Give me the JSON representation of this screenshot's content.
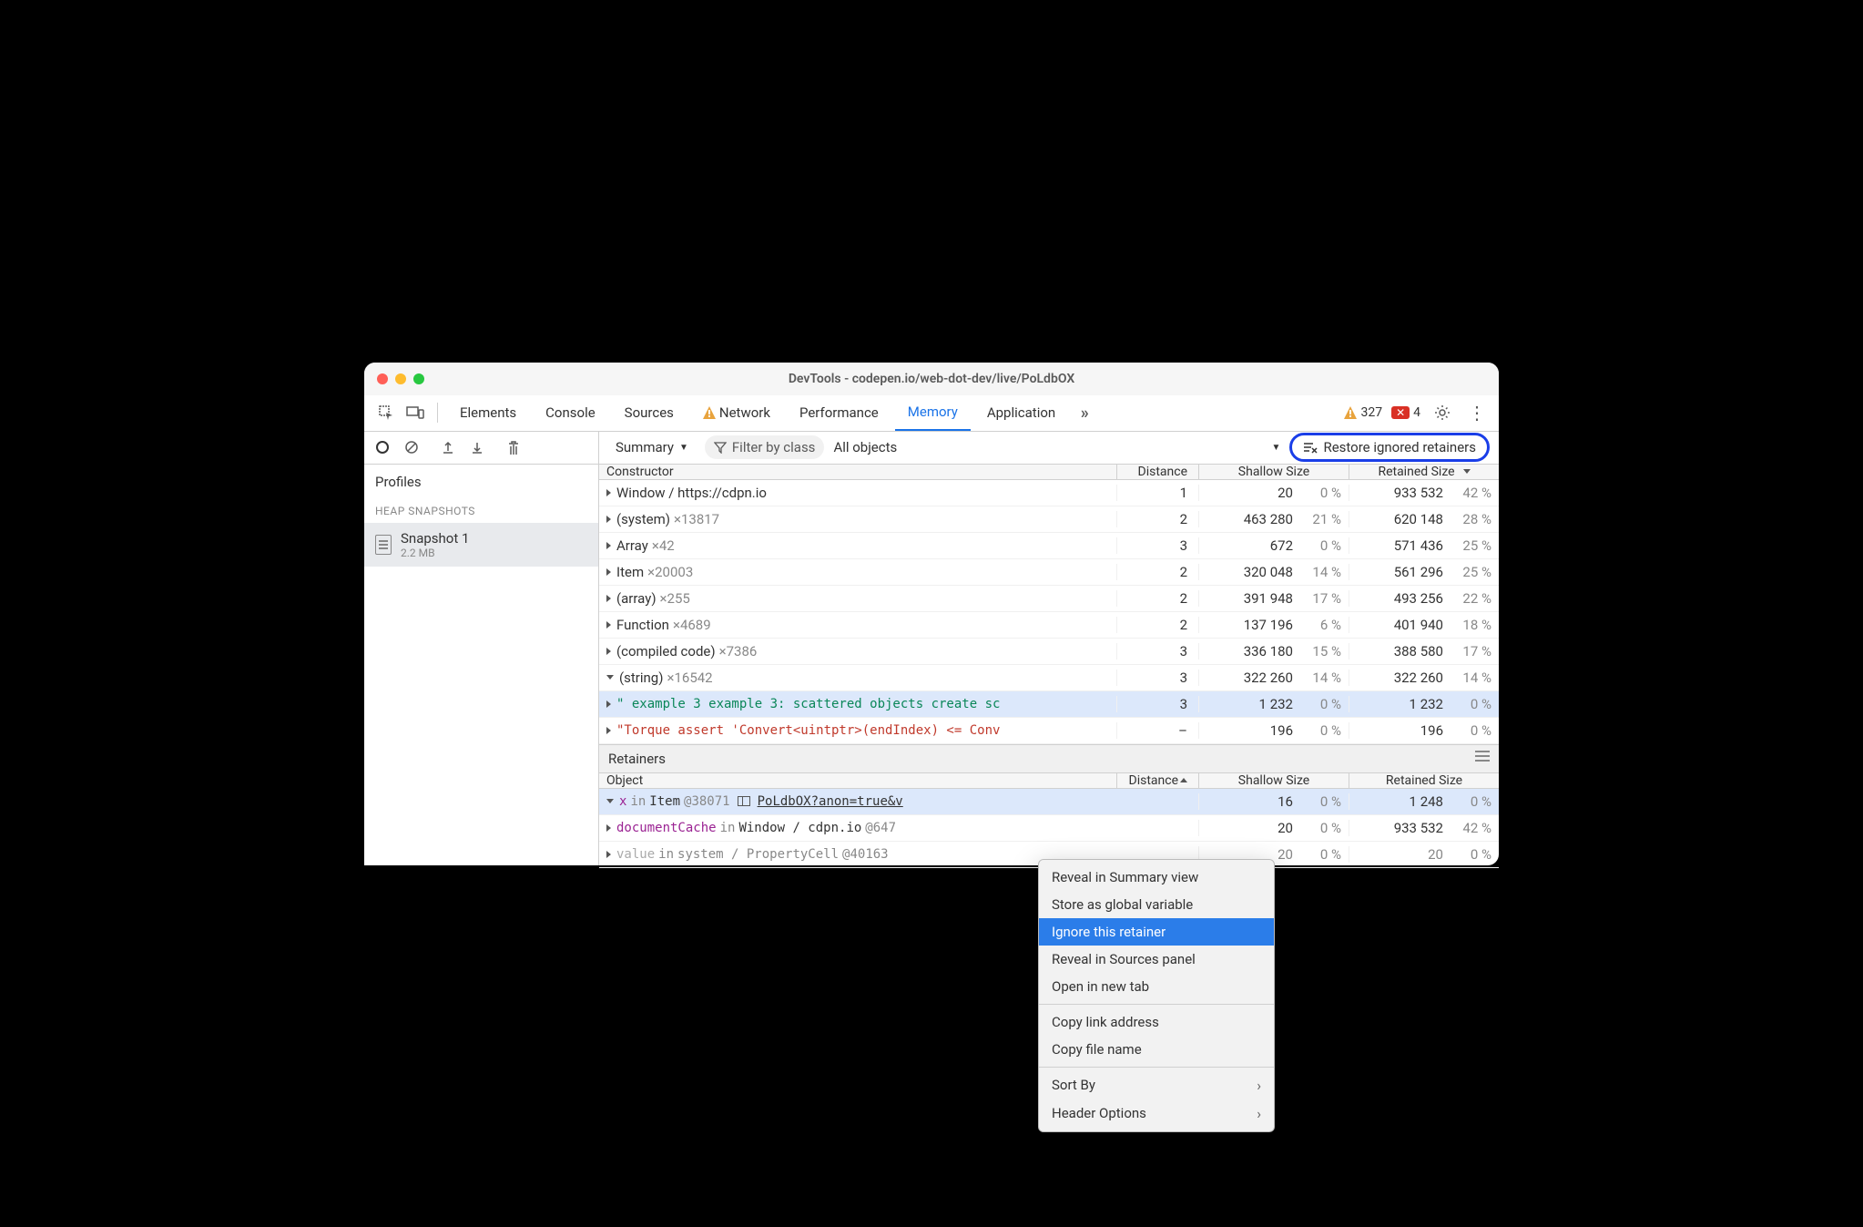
{
  "title": "DevTools - codepen.io/web-dot-dev/live/PoLdbOX",
  "tabs": [
    "Elements",
    "Console",
    "Sources",
    "Network",
    "Performance",
    "Memory",
    "Application"
  ],
  "active_tab": "Memory",
  "warnings": "327",
  "errors": "4",
  "toolbar": {
    "summary_label": "Summary",
    "filter_placeholder": "Filter by class",
    "all_objects": "All objects",
    "restore_label": "Restore ignored retainers"
  },
  "sidebar": {
    "profiles": "Profiles",
    "heap_snapshots": "HEAP SNAPSHOTS",
    "snapshot_name": "Snapshot 1",
    "snapshot_size": "2.2 MB"
  },
  "columns": {
    "constructor": "Constructor",
    "distance": "Distance",
    "shallow": "Shallow Size",
    "retained": "Retained Size",
    "object": "Object"
  },
  "rows": [
    {
      "name": "Window / https://cdpn.io",
      "count": "",
      "dist": "1",
      "sv": "20",
      "sp": "0 %",
      "rv": "933 532",
      "rp": "42 %"
    },
    {
      "name": "(system)",
      "count": "×13817",
      "dist": "2",
      "sv": "463 280",
      "sp": "21 %",
      "rv": "620 148",
      "rp": "28 %"
    },
    {
      "name": "Array",
      "count": "×42",
      "dist": "3",
      "sv": "672",
      "sp": "0 %",
      "rv": "571 436",
      "rp": "25 %"
    },
    {
      "name": "Item",
      "count": "×20003",
      "dist": "2",
      "sv": "320 048",
      "sp": "14 %",
      "rv": "561 296",
      "rp": "25 %"
    },
    {
      "name": "(array)",
      "count": "×255",
      "dist": "2",
      "sv": "391 948",
      "sp": "17 %",
      "rv": "493 256",
      "rp": "22 %"
    },
    {
      "name": "Function",
      "count": "×4689",
      "dist": "2",
      "sv": "137 196",
      "sp": "6 %",
      "rv": "401 940",
      "rp": "18 %"
    },
    {
      "name": "(compiled code)",
      "count": "×7386",
      "dist": "3",
      "sv": "336 180",
      "sp": "15 %",
      "rv": "388 580",
      "rp": "17 %"
    },
    {
      "name": "(string)",
      "count": "×16542",
      "dist": "3",
      "sv": "322 260",
      "sp": "14 %",
      "rv": "322 260",
      "rp": "14 %",
      "expanded": true
    },
    {
      "name": "\" example 3 example 3: scattered objects create sc",
      "dist": "3",
      "sv": "1 232",
      "sp": "0 %",
      "rv": "1 232",
      "rp": "0 %",
      "child": true,
      "green": true,
      "sel": true
    },
    {
      "name": "\"Torque assert 'Convert<uintptr>(endIndex) <= Conv",
      "dist": "–",
      "sv": "196",
      "sp": "0 %",
      "rv": "196",
      "rp": "0 %",
      "child": true,
      "red": true
    }
  ],
  "retainers_label": "Retainers",
  "retainer_rows": [
    {
      "pre": "x",
      "mid": " in ",
      "obj": "Item",
      "id": " @38071",
      "link": "PoLdbOX?anon=true&v",
      "dist": "",
      "sv": "16",
      "sp": "0 %",
      "rv": "1 248",
      "rp": "0 %",
      "sel": true,
      "expanded": true
    },
    {
      "pre": "documentCache",
      "mid": " in ",
      "obj": "Window / cdpn.io",
      "id": " @647",
      "dist": "",
      "sv": "20",
      "sp": "0 %",
      "rv": "933 532",
      "rp": "42 %"
    },
    {
      "pre": "value",
      "mid": " in ",
      "obj": "system / PropertyCell",
      "id": " @40163",
      "dist": "",
      "sv": "20",
      "sp": "0 %",
      "rv": "20",
      "rp": "0 %",
      "dim": true
    }
  ],
  "context_menu": [
    "Reveal in Summary view",
    "Store as global variable",
    "Ignore this retainer",
    "Reveal in Sources panel",
    "Open in new tab",
    "---",
    "Copy link address",
    "Copy file name",
    "---",
    "Sort By",
    "Header Options"
  ],
  "context_highlighted": "Ignore this retainer"
}
